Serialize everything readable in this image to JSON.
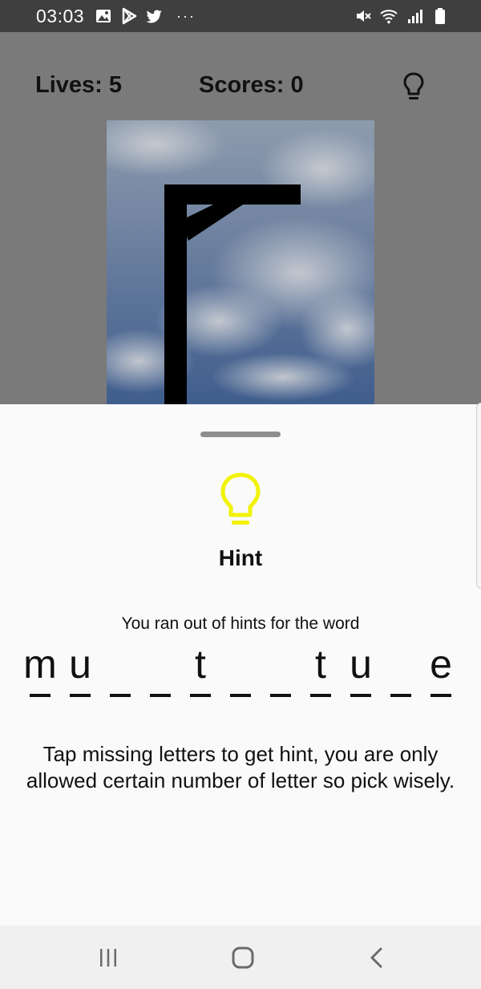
{
  "status_bar": {
    "time": "03:03",
    "left_icons": [
      "image-icon",
      "play-store-icon",
      "twitter-icon"
    ],
    "overflow_dots": "···",
    "right_icons": [
      "mute-icon",
      "wifi-icon",
      "signal-icon",
      "battery-icon"
    ]
  },
  "game": {
    "lives_text": "Lives: 5",
    "scores_text": "Scores: 0",
    "hint_icon": "lightbulb-icon"
  },
  "sheet": {
    "title": "Hint",
    "message": "You ran out of hints for the word",
    "word_letters": [
      "m",
      "u",
      "",
      "",
      "t",
      "",
      "",
      "t",
      "u",
      "",
      "e"
    ],
    "instructions": "Tap missing letters to get hint, you are only allowed certain number of letter so pick wisely.",
    "icon": "lightbulb-icon",
    "icon_color": "#f2f20a"
  },
  "nav_bar": {
    "items": [
      "recent-apps-icon",
      "home-icon",
      "back-icon"
    ]
  },
  "colors": {
    "status_bar": "#3f3f3f",
    "overlay": "#7a7a7a",
    "sheet_background": "#fafafa",
    "nav_bar": "#f0f0f0",
    "text": "#111111"
  }
}
